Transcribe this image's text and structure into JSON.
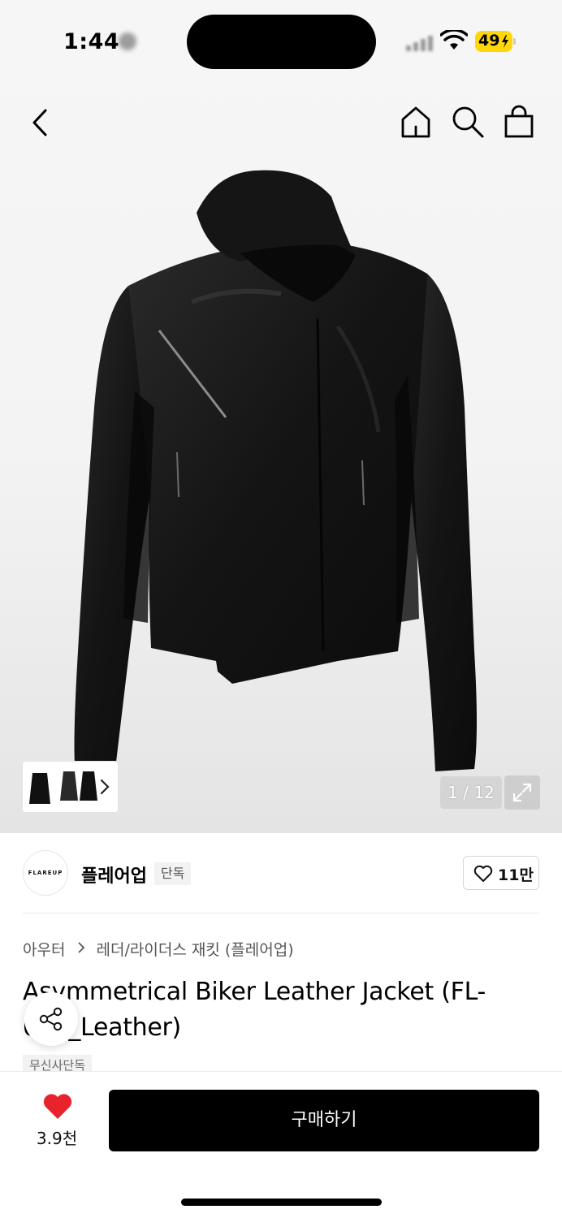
{
  "status_bar": {
    "time": "1:44",
    "battery": "49"
  },
  "gallery": {
    "counter": "1 / 12"
  },
  "brand": {
    "logo_text": "FLAREUP",
    "name": "플레어업",
    "badge": "단독",
    "like_count": "11만"
  },
  "breadcrumb": {
    "category": "아우터",
    "subcategory": "레더/라이더스 재킷 (플레어업)"
  },
  "product": {
    "title": "Asymmetrical Biker Leather Jacket (FL-047_Leather)",
    "tag": "무신사단독"
  },
  "bottom_bar": {
    "wish_count": "3.9천",
    "buy_label": "구매하기"
  },
  "colors": {
    "accent_heart": "#e8232b",
    "battery": "#ffd60a",
    "buy_button": "#000000"
  },
  "icons": [
    "back-icon",
    "home-icon",
    "search-icon",
    "bag-icon",
    "chevron-right-icon",
    "expand-icon",
    "heart-outline-icon",
    "share-icon",
    "heart-filled-icon",
    "wifi-icon"
  ]
}
